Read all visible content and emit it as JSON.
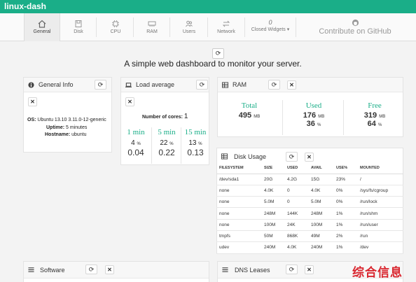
{
  "app": {
    "title": "linux-dash"
  },
  "nav": {
    "items": [
      {
        "label": "General",
        "icon": "home-icon"
      },
      {
        "label": "Disk",
        "icon": "disk-icon"
      },
      {
        "label": "CPU",
        "icon": "cpu-icon"
      },
      {
        "label": "RAM",
        "icon": "ram-icon"
      },
      {
        "label": "Users",
        "icon": "users-icon"
      },
      {
        "label": "Network",
        "icon": "network-icon"
      },
      {
        "label": "Closed Widgets",
        "badge": "0"
      }
    ],
    "github_label": "Contribute on GitHub"
  },
  "tagline": "A simple web dashboard to monitor your server.",
  "general_info": {
    "title": "General Info",
    "os_label": "OS:",
    "os_value": "Ubuntu 13.10 3.11.0-12-generic",
    "uptime_label": "Uptime:",
    "uptime_value": "5 minutes",
    "hostname_label": "Hostname:",
    "hostname_value": "ubuntu"
  },
  "load_average": {
    "title": "Load average",
    "cores_label": "Number of cores:",
    "cores_value": "1",
    "columns": [
      {
        "label": "1 min",
        "percent": "4",
        "value": "0.04"
      },
      {
        "label": "5 min",
        "percent": "22",
        "value": "0.22"
      },
      {
        "label": "15 min",
        "percent": "13",
        "value": "0.13"
      }
    ],
    "percent_unit": "%"
  },
  "ram": {
    "title": "RAM",
    "columns": [
      {
        "label": "Total",
        "value": "495",
        "unit": "MB"
      },
      {
        "label": "Used",
        "value": "176",
        "unit": "MB",
        "percent": "36",
        "percent_unit": "%"
      },
      {
        "label": "Free",
        "value": "319",
        "unit": "MB",
        "percent": "64",
        "percent_unit": "%"
      }
    ]
  },
  "disk_usage": {
    "title": "Disk Usage",
    "headers": [
      "FILESYSTEM",
      "SIZE",
      "USED",
      "AVAIL",
      "USE%",
      "MOUNTED"
    ],
    "rows": [
      [
        "/dev/sda1",
        "20G",
        "4.2G",
        "15G",
        "23%",
        "/"
      ],
      [
        "none",
        "4.0K",
        "0",
        "4.0K",
        "0%",
        "/sys/fs/cgroup"
      ],
      [
        "none",
        "5.0M",
        "0",
        "5.0M",
        "0%",
        "/run/lock"
      ],
      [
        "none",
        "248M",
        "144K",
        "248M",
        "1%",
        "/run/shm"
      ],
      [
        "none",
        "100M",
        "24K",
        "100M",
        "1%",
        "/run/user"
      ],
      [
        "tmpfs",
        "50M",
        "868K",
        "49M",
        "2%",
        "/run"
      ],
      [
        "udev",
        "240M",
        "4.0K",
        "240M",
        "1%",
        "/dev"
      ]
    ]
  },
  "software": {
    "title": "Software"
  },
  "dns_leases": {
    "title": "DNS Leases"
  },
  "overlay_text": "综合信息",
  "colors": {
    "accent": "#1aae88",
    "overlay": "#d9262f"
  }
}
